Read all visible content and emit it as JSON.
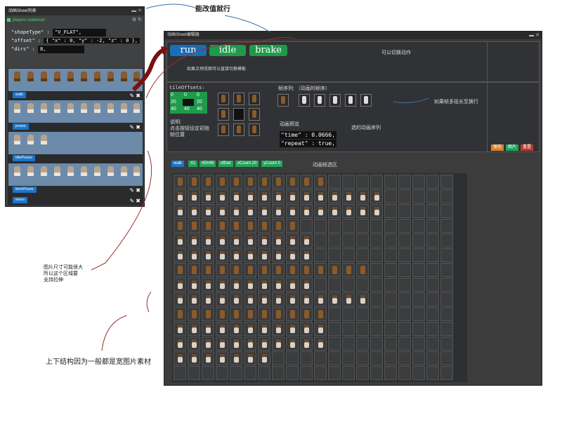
{
  "left_panel": {
    "title": "动画Sheet列表",
    "file_name": "players-stateman",
    "json": {
      "shape_type_key": "\"shapeType\"",
      "shape_type_val": "\"V_FLAT\",",
      "offset_key": "\"offset\"",
      "offset_val": "{ \"x\" : 0,  \"y\" : -2,  \"z\" : 0 },",
      "dirs_key": "\"dirs\"",
      "dirs_val": "8,"
    },
    "rows": [
      {
        "label": "walk",
        "sprites": 10,
        "style": "brown"
      },
      {
        "label": "poses",
        "sprites": 10,
        "style": "white"
      },
      {
        "label": "idlePoses",
        "sprites": 3,
        "style": "white"
      },
      {
        "label": "itemPoses",
        "sprites": 10,
        "style": "white"
      },
      {
        "label": "items",
        "sprites": 0,
        "style": "brown"
      }
    ]
  },
  "editor": {
    "title": "动画Sheet编辑器",
    "anim_buttons": [
      {
        "label": "run",
        "color": "#1a6eb5"
      },
      {
        "label": "idle",
        "color": "#1f9a4b"
      },
      {
        "label": "brake",
        "color": "#1f9a4b"
      }
    ],
    "switch_hint": "可以切换动作",
    "preview_hint": "如果点预览图可以直接切换模板",
    "tile_offsets_label": "tileOffsets:",
    "tile_offsets": [
      [
        "0",
        "0",
        "0"
      ],
      [
        "20",
        "",
        "20"
      ],
      [
        "40",
        "40",
        "40"
      ]
    ],
    "note_label": "说明:",
    "note_text_1": "点击按钮设定初始",
    "note_text_2": "帧位置",
    "frame_seq_label": "帧序列: （动画的帧序）",
    "anim_preview_label": "动画预览",
    "time_line": "\"time\" : 0.0666,",
    "repeat_line": "\"repeat\" : true,",
    "selected_seq_label": "选的动画序列",
    "extend_hint": "如果帧多延长至换行",
    "buttons": {
      "save": "保存",
      "image": "图片",
      "reset": "重置"
    },
    "tags": [
      "walk",
      "X1",
      "45X48",
      "offset",
      "xCount 20",
      "yCount 0"
    ],
    "frame_area_label": "动画帧选区"
  },
  "annotations": {
    "top": "能改值就行",
    "stretch_1": "图片尺寸可能很大",
    "stretch_2": "所以这个区域要",
    "stretch_3": "支持拉伸",
    "bottom": "上下结构因为一般都是宽图片素材"
  },
  "colors": {
    "accent_blue": "#1c75c9",
    "accent_green": "#1fa65a",
    "danger_red": "#c0392b",
    "save_orange": "#d9822b"
  }
}
